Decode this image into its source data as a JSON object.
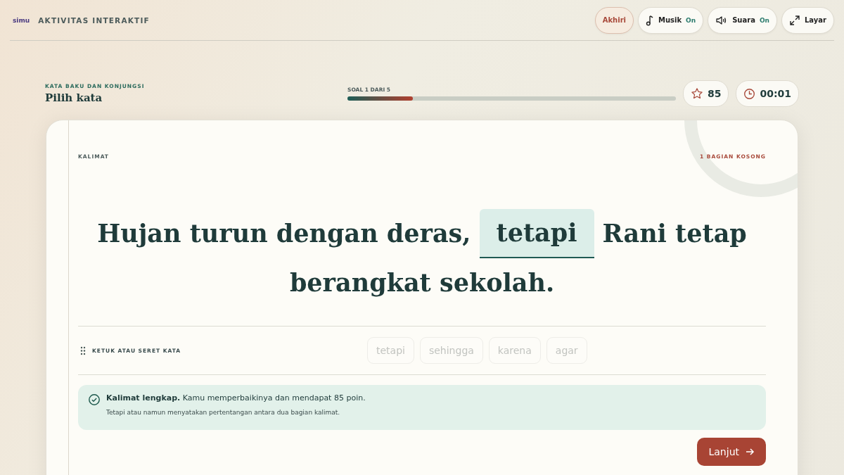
{
  "header": {
    "logo": "simu",
    "title": "AKTIVITAS INTERAKTIF",
    "buttons": [
      {
        "kind": "end",
        "label": "Akhiri"
      },
      {
        "kind": "music",
        "label": "Musik",
        "status": "On"
      },
      {
        "kind": "sound",
        "label": "Suara",
        "status": "On"
      },
      {
        "kind": "fullscreen",
        "label": "Layar"
      }
    ]
  },
  "activity": {
    "category": "KATA BAKU DAN KONJUNGSI",
    "title": "Pilih kata",
    "progress_label": "SOAL 1 DARI 5",
    "level": 0.2,
    "score": "85",
    "timer": "00:01"
  },
  "card": {
    "label": "KALIMAT",
    "blank_count": "1 BAGIAN KOSONG",
    "sentence_before": "Hujan turun dengan deras,",
    "blank_answer": "tetapi",
    "sentence_after": "Rani tetap berangkat sekolah.",
    "chips_label": "KETUK ATAU SERET KATA",
    "chips": [
      {
        "label": "tetapi",
        "disabled": true
      },
      {
        "label": "sehingga",
        "disabled": true
      },
      {
        "label": "karena",
        "disabled": true
      },
      {
        "label": "agar",
        "disabled": true
      }
    ],
    "feedback": {
      "message": "**Kalimat lengkap.** Kamu memperbaikinya dan mendapat 85 poin.",
      "explanation": "Tetapi atau namun menyatakan pertentangan antara dua bagian kalimat."
    },
    "next_button": "Lanjut"
  }
}
